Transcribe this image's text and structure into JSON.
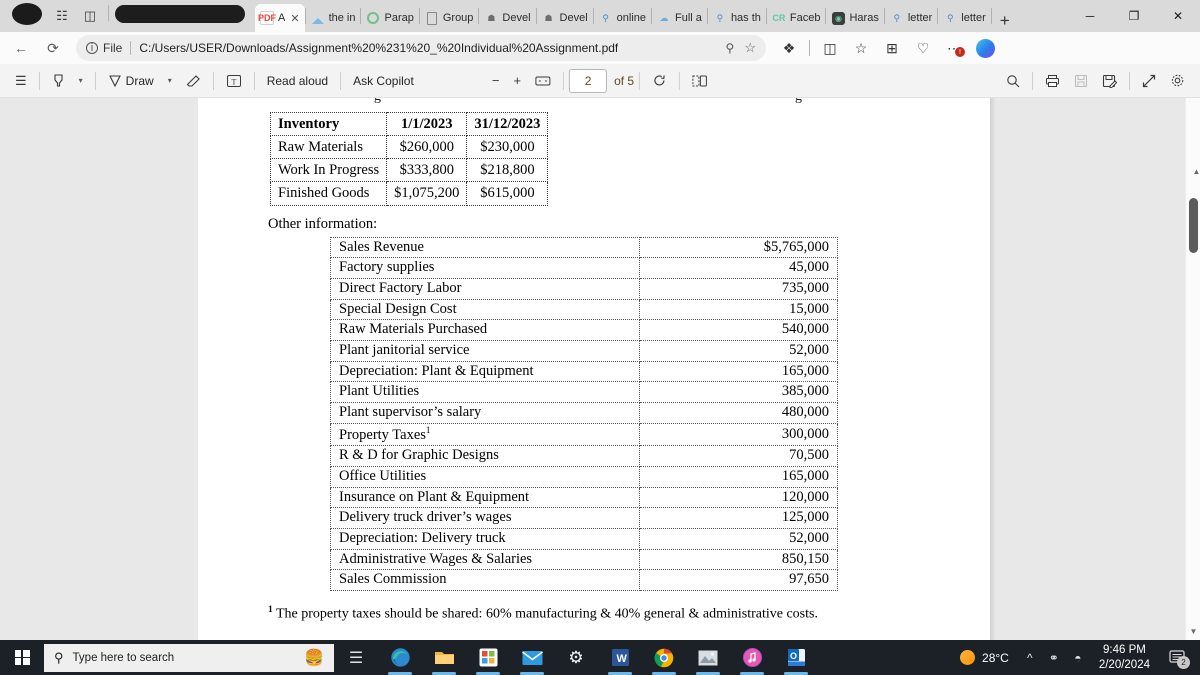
{
  "browser": {
    "tabs": [
      {
        "label": "",
        "icon": "pdf-icon",
        "active": true,
        "extra": "A",
        "closable": true
      },
      {
        "label": "the in",
        "icon": "diamond-icon",
        "active": false
      },
      {
        "label": "Parap",
        "icon": "circle-green-icon",
        "active": false
      },
      {
        "label": "Group",
        "icon": "document-icon",
        "active": false
      },
      {
        "label": "Devel",
        "icon": "shield-icon",
        "active": false
      },
      {
        "label": "Devel",
        "icon": "shield-icon",
        "active": false
      },
      {
        "label": "online",
        "icon": "search-icon",
        "active": false
      },
      {
        "label": "Full a",
        "icon": "cloud-icon",
        "active": false
      },
      {
        "label": "has th",
        "icon": "search-icon",
        "active": false
      },
      {
        "label": "Faceb",
        "icon": "cr-icon",
        "active": false
      },
      {
        "label": "Haras",
        "icon": "dark-app-icon",
        "active": false
      },
      {
        "label": "letter",
        "icon": "search-icon",
        "active": false
      },
      {
        "label": "letter",
        "icon": "search-icon",
        "active": false
      }
    ],
    "new_tab_label": "+",
    "window_controls": {
      "minimize": "─",
      "maximize": "❐",
      "close": "✕"
    },
    "nav": {
      "back": "←",
      "refresh": "⟳",
      "file_label": "File",
      "url": "C:/Users/USER/Downloads/Assignment%20%231%20_%20Individual%20Assignment.pdf",
      "zoom_icon": "zoom-icon",
      "favorite_icon": "star-icon",
      "icons": [
        "extensions-icon",
        "split-screen-icon",
        "favorites-icon",
        "collections-icon",
        "browser-essentials-icon",
        "settings-more-icon",
        "copilot-icon"
      ],
      "more_badge": "!"
    }
  },
  "pdf_toolbar": {
    "left": [
      {
        "name": "table-of-contents",
        "glyph": "☰"
      },
      {
        "name": "highlight",
        "glyph": "highlighter"
      },
      {
        "name": "highlight-dropdown",
        "glyph": "˅"
      },
      {
        "name": "draw",
        "glyph": "pen",
        "label": "Draw"
      },
      {
        "name": "draw-dropdown",
        "glyph": "˅"
      },
      {
        "name": "erase",
        "glyph": "eraser"
      },
      {
        "name": "text",
        "glyph": "T"
      },
      {
        "name": "read-aloud",
        "label": "Read aloud"
      },
      {
        "name": "ask-copilot",
        "label": "Ask Copilot"
      }
    ],
    "zoom_out": "−",
    "zoom_in": "+",
    "fit_page": "fit-icon",
    "page_number": "2",
    "page_total": "of 5",
    "rotate": "rotate-icon",
    "page_view": "page-view-icon",
    "right": [
      {
        "name": "search",
        "glyph": "⌕"
      },
      {
        "name": "print",
        "glyph": "print-icon"
      },
      {
        "name": "save",
        "glyph": "save-icon"
      },
      {
        "name": "save-as",
        "glyph": "save-as-icon"
      },
      {
        "name": "fullscreen",
        "glyph": "↗"
      },
      {
        "name": "settings",
        "glyph": "gear-icon"
      }
    ]
  },
  "document": {
    "cutoff_text": "g                                                                                    g",
    "inventory_table": {
      "headers": [
        "Inventory",
        "1/1/2023",
        "31/12/2023"
      ],
      "rows": [
        [
          "Raw Materials",
          "$260,000",
          "$230,000"
        ],
        [
          "Work In Progress",
          "$333,800",
          "$218,800"
        ],
        [
          "Finished Goods",
          "$1,075,200",
          "$615,000"
        ]
      ]
    },
    "other_info_label": "Other information:",
    "other_info": [
      {
        "item": "Sales Revenue",
        "value": "$5,765,000"
      },
      {
        "item": "Factory supplies",
        "value": "45,000"
      },
      {
        "item": "Direct Factory Labor",
        "value": "735,000"
      },
      {
        "item": "Special Design Cost",
        "value": "15,000"
      },
      {
        "item": "Raw Materials Purchased",
        "value": "540,000"
      },
      {
        "item": "Plant janitorial service",
        "value": "52,000"
      },
      {
        "item": "Depreciation: Plant & Equipment",
        "value": "165,000"
      },
      {
        "item": "Plant Utilities",
        "value": "385,000"
      },
      {
        "item": "Plant supervisor’s salary",
        "value": "480,000"
      },
      {
        "item": "Property Taxes",
        "footnote": "1",
        "value": "300,000"
      },
      {
        "item": "R & D for Graphic Designs",
        "value": "70,500"
      },
      {
        "item": "Office Utilities",
        "value": "165,000"
      },
      {
        "item": "Insurance on Plant & Equipment",
        "value": "120,000"
      },
      {
        "item": "Delivery truck driver’s wages",
        "value": "125,000"
      },
      {
        "item": "Depreciation: Delivery truck",
        "value": "52,000"
      },
      {
        "item": "Administrative Wages & Salaries",
        "value": "850,150"
      },
      {
        "item": "Sales Commission",
        "value": "97,650"
      }
    ],
    "footnote_marker": "1",
    "footnote_text": "The property taxes should be shared: 60% manufacturing & 40% general & administrative costs."
  },
  "taskbar": {
    "search_placeholder": "Type here to search",
    "pinned": [
      "task-view-icon",
      "edge-icon",
      "file-explorer-icon",
      "microsoft-store-icon",
      "mail-icon",
      "settings-icon",
      "word-icon",
      "chrome-icon",
      "photos-icon",
      "itunes-icon",
      "outlook-new-icon"
    ],
    "weather_temp": "28°C",
    "time": "9:46 PM",
    "date": "2/20/2024",
    "notification_count": "2"
  }
}
